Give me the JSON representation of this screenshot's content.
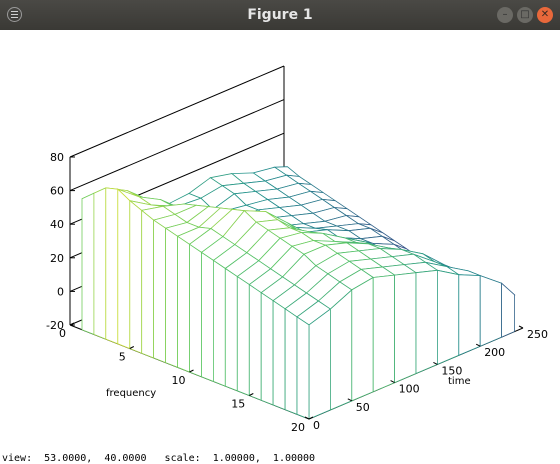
{
  "window": {
    "title": "Figure 1",
    "minimize_glyph": "–",
    "maximize_glyph": "□",
    "close_glyph": "✕"
  },
  "status": {
    "text": "view:  53.0000,  40.0000   scale:  1.00000,  1.00000"
  },
  "colors": {
    "titlebar": "#3c3b37",
    "close": "#e8683b",
    "colormap": "viridis"
  },
  "chart_data": {
    "type": "surface",
    "view": [
      53,
      40
    ],
    "xlabel": "time",
    "ylabel": "frequency",
    "zlabel": "",
    "xlim": [
      0,
      250
    ],
    "ylim": [
      0,
      20
    ],
    "zlim": [
      -20,
      80
    ],
    "xticks": [
      "0",
      "50",
      "100",
      "150",
      "200",
      "250"
    ],
    "yticks": [
      "0",
      "5",
      "10",
      "15",
      "20"
    ],
    "zticks": [
      "80",
      "60",
      "40",
      "20",
      "0",
      "-20"
    ],
    "frequency_bins": [
      1,
      2,
      3,
      4,
      5,
      6,
      7,
      8,
      9,
      10,
      11,
      12,
      13,
      14,
      15,
      16,
      17,
      18,
      19,
      20
    ],
    "time_samples": [
      0,
      25,
      50,
      75,
      100,
      125,
      150,
      175,
      200,
      225,
      240
    ],
    "series": [
      {
        "values": [
          [
            58,
            55,
            42,
            38,
            33,
            34,
            38,
            35,
            30,
            28,
            25
          ],
          [
            64,
            60,
            46,
            40,
            35,
            34,
            36,
            32,
            28,
            26,
            22
          ],
          [
            70,
            63,
            52,
            42,
            34,
            30,
            34,
            30,
            26,
            24,
            20
          ],
          [
            72,
            62,
            55,
            44,
            36,
            32,
            30,
            28,
            24,
            22,
            18
          ],
          [
            68,
            60,
            54,
            46,
            38,
            30,
            30,
            26,
            22,
            20,
            16
          ],
          [
            65,
            62,
            58,
            48,
            36,
            30,
            28,
            24,
            20,
            18,
            14
          ],
          [
            62,
            60,
            60,
            50,
            38,
            32,
            26,
            22,
            18,
            16,
            12
          ],
          [
            60,
            58,
            62,
            52,
            40,
            30,
            28,
            22,
            18,
            14,
            10
          ],
          [
            58,
            58,
            64,
            56,
            44,
            34,
            28,
            24,
            18,
            14,
            8
          ],
          [
            56,
            60,
            66,
            58,
            46,
            36,
            30,
            22,
            16,
            12,
            6
          ],
          [
            54,
            58,
            68,
            62,
            50,
            38,
            30,
            24,
            16,
            10,
            4
          ],
          [
            52,
            56,
            64,
            60,
            48,
            40,
            30,
            22,
            14,
            8,
            2
          ],
          [
            50,
            54,
            62,
            58,
            50,
            42,
            34,
            24,
            14,
            6,
            0
          ],
          [
            48,
            52,
            60,
            58,
            52,
            44,
            36,
            26,
            16,
            6,
            -2
          ],
          [
            46,
            50,
            58,
            56,
            50,
            44,
            36,
            28,
            16,
            4,
            -2
          ],
          [
            44,
            48,
            56,
            56,
            52,
            46,
            38,
            30,
            18,
            6,
            -4
          ],
          [
            42,
            46,
            52,
            54,
            50,
            46,
            40,
            32,
            20,
            6,
            -4
          ],
          [
            40,
            44,
            50,
            52,
            48,
            44,
            40,
            30,
            20,
            8,
            -2
          ],
          [
            38,
            42,
            48,
            50,
            46,
            42,
            38,
            30,
            22,
            10,
            0
          ],
          [
            36,
            40,
            46,
            48,
            44,
            40,
            36,
            28,
            22,
            12,
            2
          ]
        ]
      }
    ]
  }
}
